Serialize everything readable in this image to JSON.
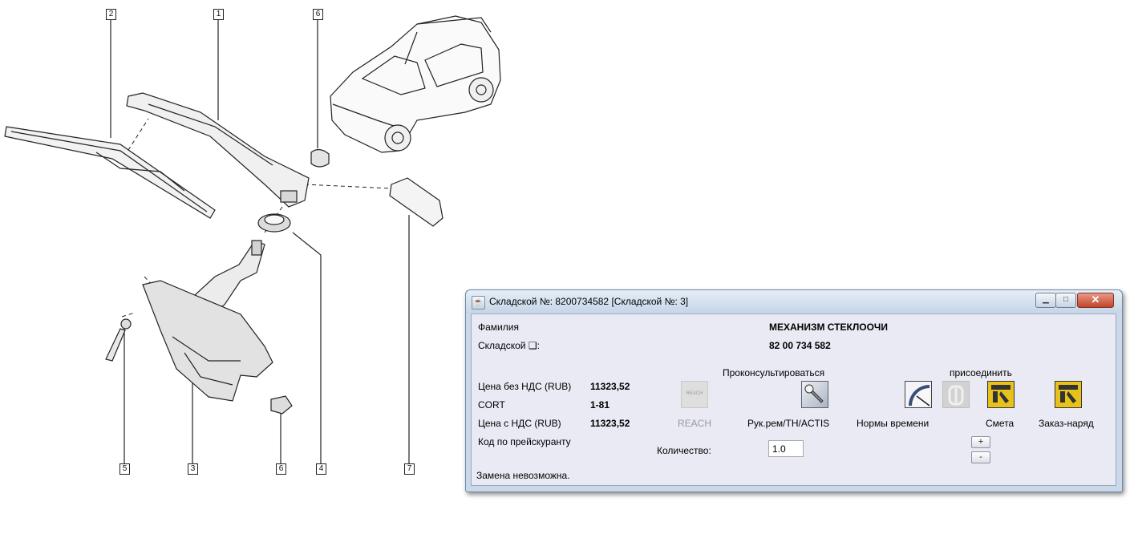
{
  "diagram": {
    "callouts": [
      "2",
      "1",
      "6",
      "5",
      "3",
      "6",
      "4",
      "7"
    ]
  },
  "window": {
    "title": "Складской №: 8200734582 [Складской №: 3]",
    "controls": {
      "minimize": "▁",
      "maximize": "□",
      "close": "✕"
    }
  },
  "fields": {
    "family_label": "Фамилия",
    "family_value": "МЕХАНИЗМ СТЕКЛООЧИ",
    "stock_label": "Складской ❑:",
    "stock_value": "82 00 734 582",
    "price_net_label": "Цена без НДС (RUB)",
    "price_net_value": "11323,52",
    "cort_label": "CORT",
    "cort_value": "1-81",
    "price_vat_label": "Цена с НДС (RUB)",
    "price_vat_value": "11323,52",
    "price_code_label": "Код по прейскуранту",
    "status": "Замена невозможна."
  },
  "actions": {
    "consult_header": "Проконсультироваться",
    "attach_header": "присоединить",
    "reach": "REACH",
    "reach_icon_text": "REACH",
    "manual": "Рук.рем/TH/ACTIS",
    "time_norms": "Нормы времени",
    "estimate": "Смета",
    "work_order": "Заказ-наряд"
  },
  "quantity": {
    "label": "Количество:",
    "value": "1.0",
    "plus": "+",
    "minus": "-"
  },
  "colors": {
    "window_frame": "#c9d9ea",
    "panel": "#eaeaf4",
    "close_button": "#c2452b",
    "icon_yellow": "#e8c21a"
  }
}
